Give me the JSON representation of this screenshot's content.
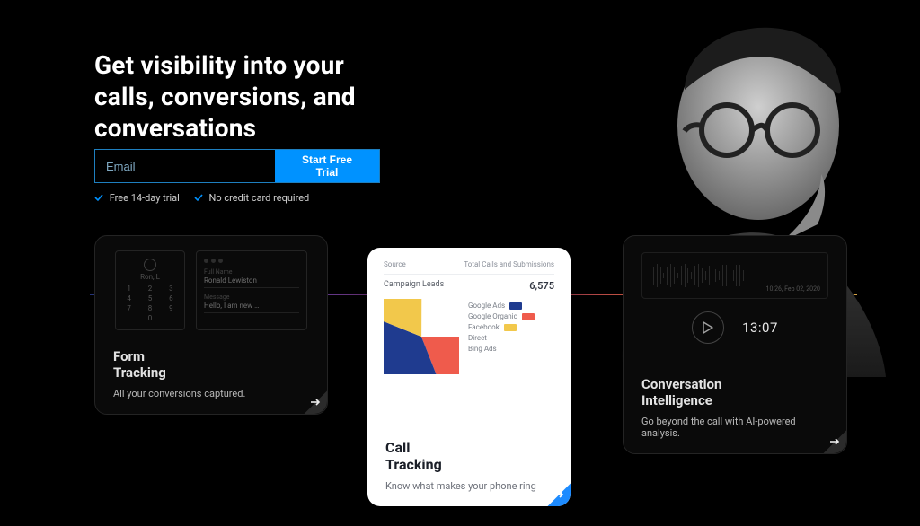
{
  "hero": {
    "headline": "Get visibility into your calls, conversions, and conversations"
  },
  "signup": {
    "email_placeholder": "Email",
    "cta_label": "Start Free Trial",
    "benefit_1": "Free 14-day trial",
    "benefit_2": "No credit card required"
  },
  "cards": {
    "form_tracking": {
      "title_line1": "Form",
      "title_line2": "Tracking",
      "subtitle": "All your conversions captured.",
      "mini_phone": {
        "contact_name": "Ron, L",
        "keys": [
          "1",
          "2",
          "3",
          "4",
          "5",
          "6",
          "7",
          "8",
          "9",
          "",
          "0",
          ""
        ]
      },
      "mini_form": {
        "field1_label": "Full Name",
        "field1_value": "Ronald  Lewiston",
        "field2_label": "Message",
        "field2_value": "Hello, I am new …"
      }
    },
    "call_tracking": {
      "title_line1": "Call",
      "title_line2": "Tracking",
      "subtitle": "Know what makes your phone ring",
      "table": {
        "col1": "Source",
        "col2": "Total Calls and Submissions",
        "row_label": "Campaign Leads",
        "row_value": "6,575"
      },
      "legend": [
        {
          "label": "Google Ads",
          "color": "#1f3b8f"
        },
        {
          "label": "Google Organic",
          "color": "#ef5b4c"
        },
        {
          "label": "Facebook",
          "color": "#f2c84b"
        },
        {
          "label": "Direct",
          "color": ""
        },
        {
          "label": "Bing Ads",
          "color": ""
        }
      ]
    },
    "conversation_intelligence": {
      "title_line1": "Conversation",
      "title_line2": "Intelligence",
      "subtitle": "Go beyond the call with AI-powered analysis.",
      "timestamp_label": "13:07",
      "waveform_caption": "10:26, Feb 02, 2020"
    }
  },
  "chart_data": {
    "type": "pie",
    "title": "Campaign Leads",
    "total": 6575,
    "series": [
      {
        "name": "Google Ads",
        "value": 37,
        "color": "#1f3b8f"
      },
      {
        "name": "Google Organic",
        "value": 44,
        "color": "#ef5b4c"
      },
      {
        "name": "Facebook",
        "value": 19,
        "color": "#f2c84b"
      }
    ]
  }
}
